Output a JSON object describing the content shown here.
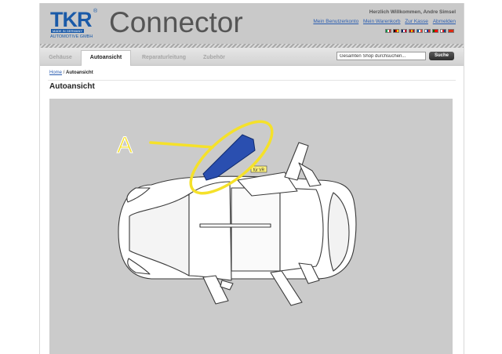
{
  "header": {
    "logo_text": "TKR",
    "logo_registered": "®",
    "logo_made_in": "MADE IN GERMANY",
    "logo_subtitle": "AUTOMOTIVE GMBH",
    "brand_title": "Connector",
    "welcome_text": "Herzlich Willkommen, Andre Simsel",
    "links": [
      "Mein Benutzerkonto",
      "Mein Warenkorb",
      "Zur Kasse",
      "Abmelden"
    ],
    "flags": [
      {
        "name": "it-flag",
        "colors": [
          "#009246",
          "#ffffff",
          "#ce2b37"
        ]
      },
      {
        "name": "de-flag",
        "colors": [
          "#000000",
          "#dd0000",
          "#ffce00"
        ]
      },
      {
        "name": "uk-flag",
        "colors": [
          "#012169",
          "#ffffff",
          "#c8102e"
        ]
      },
      {
        "name": "es-flag",
        "colors": [
          "#aa151b",
          "#f1bf00",
          "#aa151b"
        ]
      },
      {
        "name": "fr-flag",
        "colors": [
          "#0055a4",
          "#ffffff",
          "#ef4135"
        ]
      },
      {
        "name": "ru-flag",
        "colors": [
          "#ffffff",
          "#0039a6",
          "#d52b1e"
        ]
      },
      {
        "name": "pt-flag",
        "colors": [
          "#006600",
          "#ff0000",
          "#ff0000"
        ]
      },
      {
        "name": "cz-flag",
        "colors": [
          "#ffffff",
          "#d7141a",
          "#11457e"
        ]
      },
      {
        "name": "cn-flag",
        "colors": [
          "#de2910",
          "#de2910",
          "#de2910"
        ]
      }
    ]
  },
  "nav": {
    "tabs": [
      "Gehäuse",
      "Autoansicht",
      "Reparaturleitung",
      "Zubehör"
    ],
    "active_tab": "Autoansicht"
  },
  "search": {
    "value": "Gesamten Shop durchsuchen...",
    "button_label": "Suche"
  },
  "breadcrumb": {
    "home": "Home",
    "separator": " / ",
    "current": "Autoansicht"
  },
  "main": {
    "title": "Autoansicht"
  },
  "diagram": {
    "callout_label": "A",
    "tag_label": "für VR",
    "highlight_color": "#f5e12a",
    "part_color": "#2a4fb0",
    "background_color": "#cbcbcb"
  },
  "colors": {
    "logo_blue": "#1a5aa8",
    "link_blue": "#2a5db0",
    "header_gray": "#c9c9c9"
  }
}
